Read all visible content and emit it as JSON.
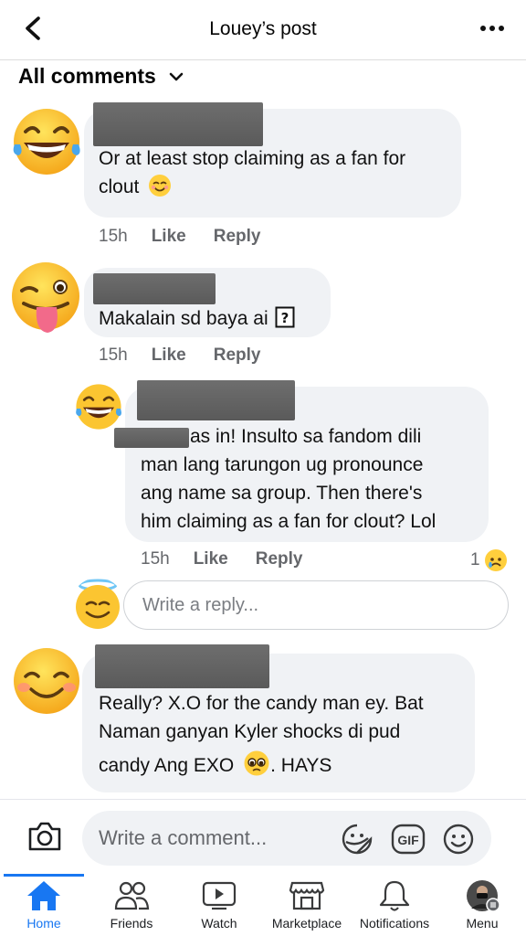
{
  "header": {
    "title": "Louey’s post"
  },
  "filter": {
    "label": "All comments"
  },
  "comments": [
    {
      "lines": [
        "Or at least stop claiming as a fan for",
        "clout"
      ],
      "time": "15h",
      "like": "Like",
      "reply": "Reply"
    },
    {
      "text": "Makalain sd baya ai",
      "time": "15h",
      "like": "Like",
      "reply": "Reply"
    },
    {
      "lines": [
        "as in! Insulto sa fandom dili",
        "man lang tarungon ug pronounce",
        "ang name sa group. Then there's",
        "him claiming as a fan for clout? Lol"
      ],
      "time": "15h",
      "like": "Like",
      "reply": "Reply",
      "reaction_count": "1"
    },
    {
      "lines": [
        "Really? X.O for the candy man ey. Bat",
        "Naman ganyan Kyler shocks di pud",
        "candy Ang EXO",
        ". HAYS"
      ]
    }
  ],
  "reply_input": {
    "placeholder": "Write a reply..."
  },
  "composer": {
    "placeholder": "Write a comment..."
  },
  "nav": [
    {
      "label": "Home"
    },
    {
      "label": "Friends"
    },
    {
      "label": "Watch"
    },
    {
      "label": "Marketplace"
    },
    {
      "label": "Notifications"
    },
    {
      "label": "Menu"
    }
  ],
  "colors": {
    "accent": "#1877f2",
    "bubble": "#f0f2f5",
    "meta": "#65676b"
  }
}
